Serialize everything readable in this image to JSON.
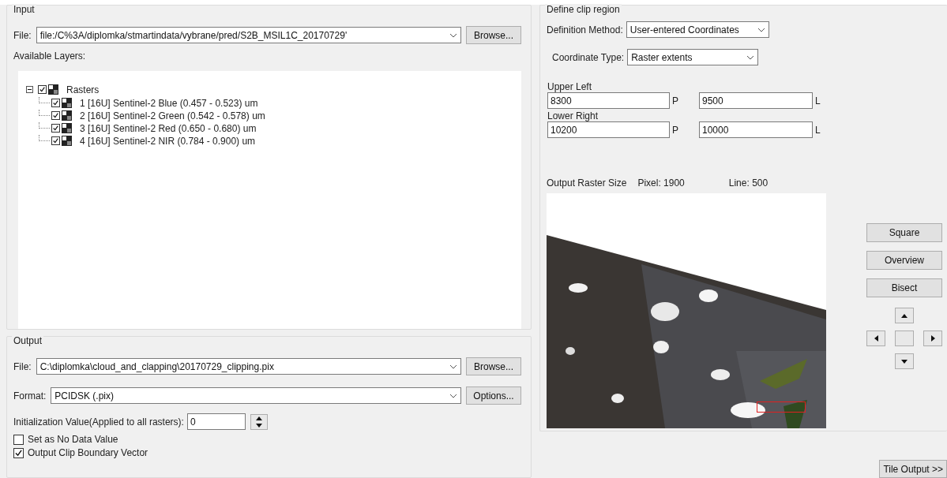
{
  "input": {
    "title": "Input",
    "file": {
      "label": "File:",
      "value": "file:/C%3A/diplomka/stmartindata/vybrane/pred/S2B_MSIL1C_20170729'",
      "button": "Browse..."
    },
    "layers_label": "Available Layers:",
    "tree": {
      "label": "Rasters",
      "expanded": true,
      "checked": true,
      "children": [
        {
          "label": "1 [16U] Sentinel-2 Blue (0.457 - 0.523) um",
          "checked": true
        },
        {
          "label": "2 [16U] Sentinel-2 Green (0.542 - 0.578) um",
          "checked": true
        },
        {
          "label": "3 [16U] Sentinel-2 Red (0.650 - 0.680) um",
          "checked": true
        },
        {
          "label": "4 [16U] Sentinel-2 NIR (0.784 - 0.900) um",
          "checked": true
        }
      ]
    }
  },
  "output": {
    "title": "Output",
    "file": {
      "label": "File:",
      "value": "C:\\diplomka\\cloud_and_clapping\\20170729_clipping.pix",
      "button": "Browse..."
    },
    "format": {
      "label": "Format:",
      "value": "PCIDSK (.pix)",
      "button": "Options..."
    },
    "init": {
      "label": "Initialization Value(Applied to all rasters):",
      "value": "0"
    },
    "options": [
      {
        "label": "Set as No Data Value",
        "checked": false
      },
      {
        "label": "Output Clip Boundary Vector",
        "checked": true
      }
    ]
  },
  "clip": {
    "title": "Define clip region",
    "method": {
      "label": "Definition Method:",
      "value": "User-entered Coordinates"
    },
    "coord_type": {
      "label": "Coordinate Type:",
      "value": "Raster extents"
    },
    "corners": [
      {
        "label": "Upper Left",
        "p_value": "8300",
        "p_unit": "P",
        "l_value": "9500",
        "l_unit": "L"
      },
      {
        "label": "Lower Right",
        "p_value": "10200",
        "p_unit": "P",
        "l_value": "10000",
        "l_unit": "L"
      }
    ],
    "size": {
      "label": "Output Raster Size",
      "pixel_label": "Pixel:",
      "pixel": "1900",
      "line_label": "Line:",
      "line": "500"
    },
    "buttons": [
      "Square",
      "Overview",
      "Bisect"
    ]
  },
  "tile_button": "Tile Output >>"
}
